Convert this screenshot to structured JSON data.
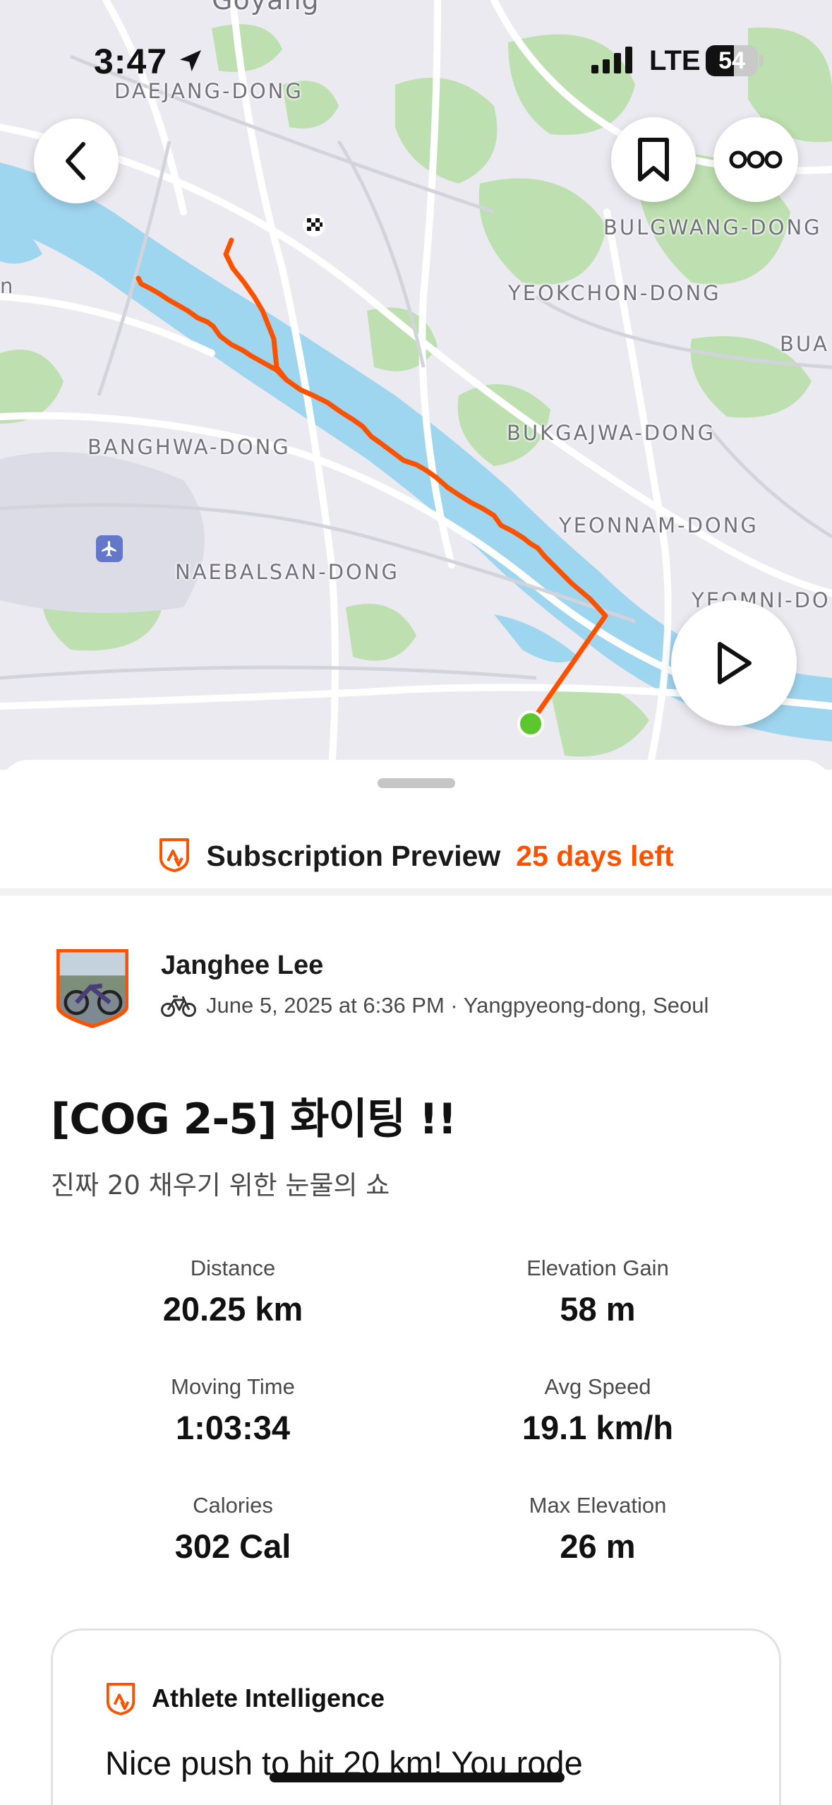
{
  "status_bar": {
    "time": "3:47",
    "network": "LTE",
    "battery": "54",
    "battery_level_pct": 54,
    "location_icon": "location-arrow-icon",
    "signal_icon": "cellular-signal-icon"
  },
  "map": {
    "labels": {
      "goyang": "Goyang",
      "daejang": "DAEJANG-DONG",
      "bulgwang": "BULGWANG-DONG",
      "yeokchon": "YEOKCHON-DONG",
      "bua": "BUA",
      "bukgajwa": "BUKGAJWA-DONG",
      "banghwa": "BANGHWA-DONG",
      "yeonnam": "YEONNAM-DONG",
      "naebalsan": "NAEBALSAN-DONG",
      "yeomni": "YEOMNI-DO",
      "left_edge": "n"
    },
    "route_color": "#fc5200",
    "start_color": "#5cc62d",
    "airport_icon": "airplane-icon",
    "finish_icon": "checkered-flag-icon"
  },
  "controls": {
    "back_icon": "chevron-left-icon",
    "bookmark_icon": "bookmark-icon",
    "more_icon": "more-dots-icon",
    "play_icon": "play-icon"
  },
  "subscription": {
    "title": "Subscription Preview",
    "days_left": "25 days left",
    "accent": "#fc5200"
  },
  "athlete": {
    "name": "Janghee Lee",
    "meta": "June 5, 2025 at 6:36 PM · Yangpyeong-dong, Seoul",
    "sport_icon": "bike-icon"
  },
  "activity": {
    "title": "[COG 2-5] 화이팅 !!",
    "description": "진짜 20 채우기 위한 눈물의 쇼"
  },
  "stats": [
    {
      "label": "Distance",
      "value": "20.25 km"
    },
    {
      "label": "Elevation Gain",
      "value": "58 m"
    },
    {
      "label": "Moving Time",
      "value": "1:03:34"
    },
    {
      "label": "Avg Speed",
      "value": "19.1 km/h"
    },
    {
      "label": "Calories",
      "value": "302 Cal"
    },
    {
      "label": "Max Elevation",
      "value": "26 m"
    }
  ],
  "athlete_intelligence": {
    "title": "Athlete Intelligence",
    "text": "Nice push to hit 20 km! You rode"
  }
}
